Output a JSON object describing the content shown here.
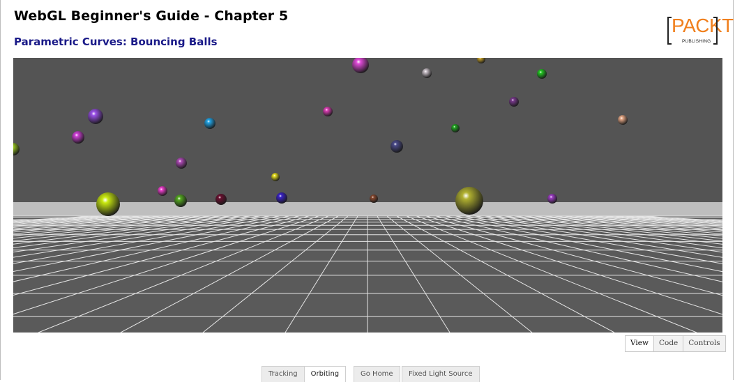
{
  "header": {
    "title": "WebGL Beginner's Guide - Chapter 5",
    "subtitle": "Parametric Curves: Bouncing Balls"
  },
  "logo": {
    "word": "PACKT",
    "tagline": "PUBLISHING"
  },
  "view_tabs": [
    {
      "label": "View",
      "active": true
    },
    {
      "label": "Code",
      "active": false
    },
    {
      "label": "Controls",
      "active": false
    }
  ],
  "camera_buttons": [
    {
      "label": "Tracking",
      "active": false
    },
    {
      "label": "Orbiting",
      "active": true
    }
  ],
  "home_button": {
    "label": "Go Home"
  },
  "light_button": {
    "label": "Fixed Light Source"
  },
  "colors": {
    "title": "#000000",
    "subtitle": "#1a1a88",
    "logo_orange": "#f0801e",
    "scene_background": "#545454",
    "floor": "#bebebe",
    "grid_lines": "#e6e6e6"
  },
  "scene": {
    "balls": [
      {
        "color": "#e04ad8"
      },
      {
        "color": "#c9c0c8"
      },
      {
        "color": "#c8a22a"
      },
      {
        "color": "#22c822"
      },
      {
        "color": "#7a3a8e"
      },
      {
        "color": "#e040b8"
      },
      {
        "color": "#9a50e8"
      },
      {
        "color": "#22a6e8"
      },
      {
        "color": "#22aa22"
      },
      {
        "color": "#e8aa88"
      },
      {
        "color": "#d040d8"
      },
      {
        "color": "#9ac820"
      },
      {
        "color": "#4a4a88"
      },
      {
        "color": "#b04ab8"
      },
      {
        "color": "#e8e020"
      },
      {
        "color": "#f040d0"
      },
      {
        "color": "#55aa22"
      },
      {
        "color": "#6a1030"
      },
      {
        "color": "#3a22c8"
      },
      {
        "color": "#8a4a30"
      },
      {
        "color": "#c8e810"
      },
      {
        "color": "#b0b030"
      },
      {
        "color": "#a040c8"
      }
    ]
  }
}
